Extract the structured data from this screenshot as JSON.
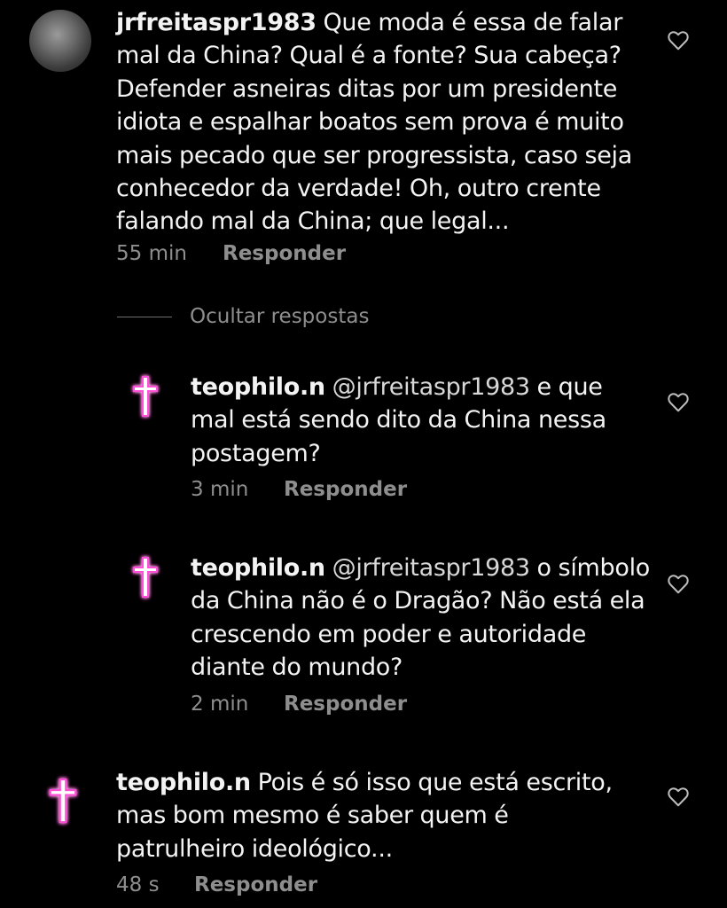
{
  "comments": [
    {
      "username": "jrfreitaspr1983",
      "text": "Que moda é essa de falar mal da China? Qual é a fonte? Sua cabeça? Defender asneiras ditas por um presidente idiota  e espalhar boatos sem prova é muito mais pecado que ser progressista, caso seja conhecedor da verdade! Oh, outro crente falando mal da China; que legal...",
      "time": "55 min",
      "reply_label": "Responder",
      "avatar": "profile-photo",
      "like_icon": "heart-outline-icon"
    }
  ],
  "hide_replies_label": "Ocultar respostas",
  "replies": [
    {
      "username": "teophilo.n",
      "mention": "@jrfreitaspr1983",
      "text": "e que mal está sendo dito da China nessa postagem?",
      "time": "3 min",
      "reply_label": "Responder",
      "avatar": "neon-cross-icon",
      "like_icon": "heart-outline-icon"
    },
    {
      "username": "teophilo.n",
      "mention": "@jrfreitaspr1983",
      "text": "o símbolo da China não é o Dragão? Não está ela crescendo em poder e autoridade diante do mundo?",
      "time": "2 min",
      "reply_label": "Responder",
      "avatar": "neon-cross-icon",
      "like_icon": "heart-outline-icon"
    }
  ],
  "bottom_comment": {
    "username": "teophilo.n",
    "text": "Pois é só isso que está escrito, mas bom mesmo é saber quem é patrulheiro ideológico...",
    "time": "48 s",
    "reply_label": "Responder",
    "avatar": "neon-cross-icon",
    "like_icon": "heart-outline-icon"
  },
  "colors": {
    "background": "#000000",
    "text": "#f3f3f3",
    "meta": "#8e8e8e",
    "neon_pink": "#ff4fd8"
  }
}
